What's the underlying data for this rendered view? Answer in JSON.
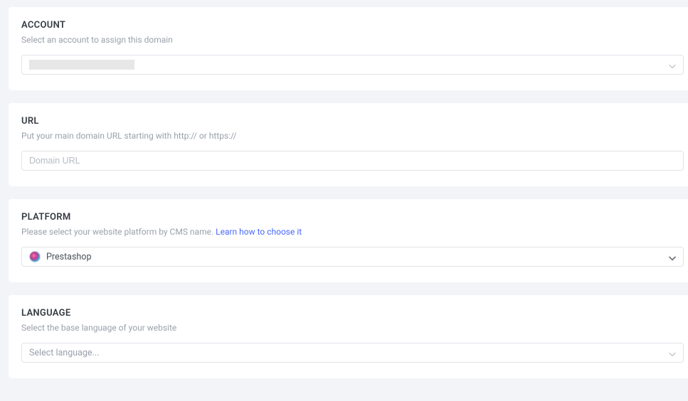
{
  "account": {
    "title": "ACCOUNT",
    "description": "Select an account to assign this domain"
  },
  "url": {
    "title": "URL",
    "description": "Put your main domain URL starting with http:// or https://",
    "placeholder": "Domain URL"
  },
  "platform": {
    "title": "PLATFORM",
    "desc_prefix": "Please select your website platform by CMS name.  ",
    "link_label": "Learn how to choose it",
    "selected": "Prestashop"
  },
  "language": {
    "title": "LANGUAGE",
    "description": "Select the base language of your website",
    "placeholder": "Select language..."
  }
}
